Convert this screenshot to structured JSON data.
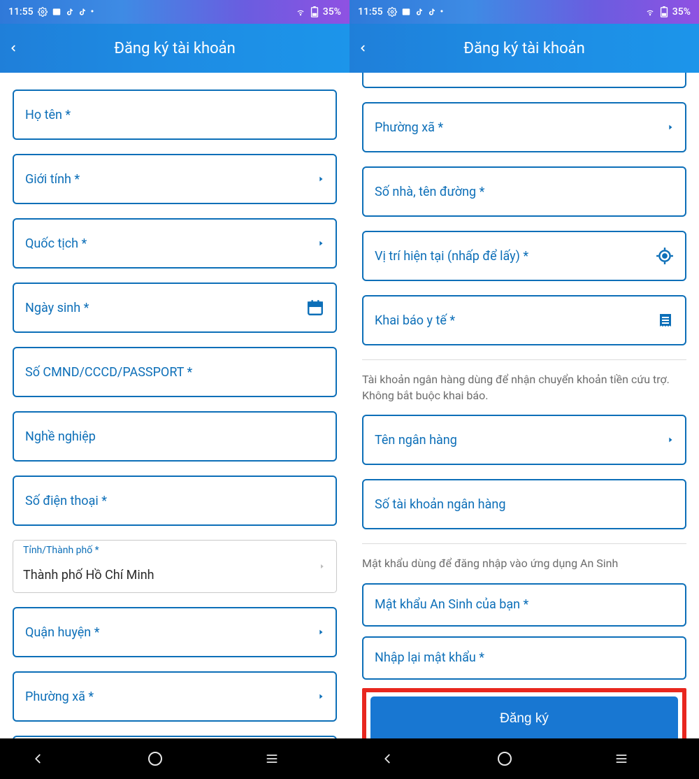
{
  "status": {
    "time": "11:55",
    "battery": "35%"
  },
  "appbar": {
    "title": "Đăng ký tài khoản"
  },
  "left": {
    "fields": {
      "fullname": {
        "label": "Họ tên *"
      },
      "gender": {
        "label": "Giới tính *"
      },
      "nationality": {
        "label": "Quốc tịch *"
      },
      "dob": {
        "label": "Ngày sinh *"
      },
      "idnumber": {
        "label": "Số CMND/CCCD/PASSPORT *"
      },
      "job": {
        "label": "Nghề nghiệp"
      },
      "phone": {
        "label": "Số điện thoại *"
      },
      "province": {
        "float": "Tỉnh/Thành phố *",
        "value": "Thành phố Hồ Chí Minh"
      },
      "district": {
        "label": "Quận huyện *"
      },
      "ward": {
        "label": "Phường xã *"
      }
    }
  },
  "right": {
    "fields": {
      "ward": {
        "label": "Phường xã *"
      },
      "address": {
        "label": "Số nhà, tên đường *"
      },
      "location": {
        "label": "Vị trí hiện tại (nhấp để lấy) *"
      },
      "health": {
        "label": "Khai báo y tế *"
      },
      "bank_help": "Tài khoản ngân hàng dùng để nhận chuyển khoản tiền cứu trợ. Không bắt buộc khai báo.",
      "bankname": {
        "label": "Tên ngân hàng"
      },
      "bankacct": {
        "label": "Số tài khoản ngân hàng"
      },
      "pw_help": "Mật khẩu dùng để đăng nhập vào ứng dụng An Sinh",
      "password": {
        "label": "Mật khẩu An Sinh của bạn *"
      },
      "password2": {
        "label": "Nhập lại mật khẩu *"
      },
      "submit": "Đăng ký"
    }
  }
}
